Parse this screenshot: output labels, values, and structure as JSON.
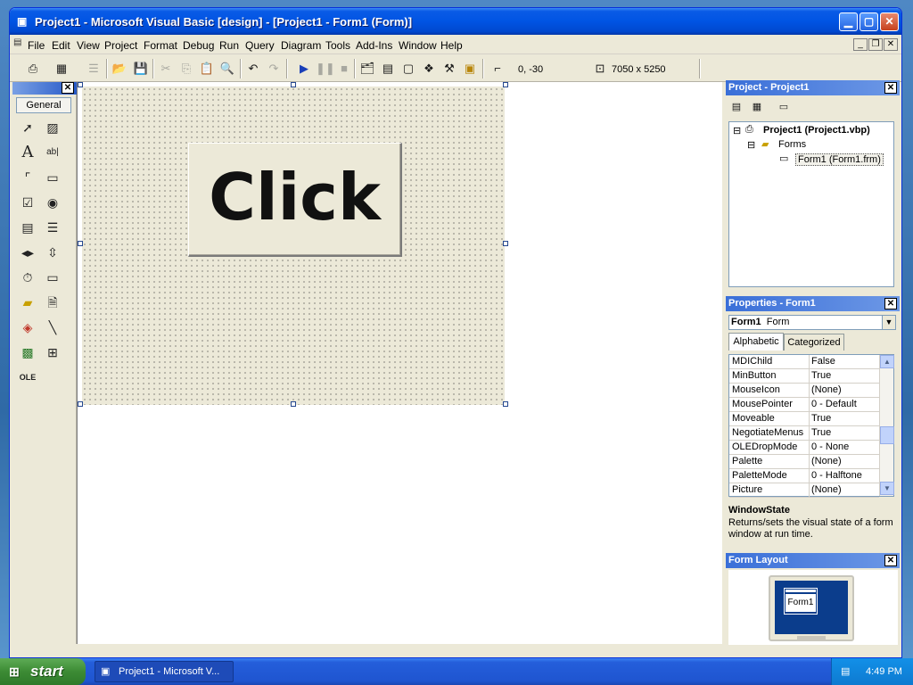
{
  "window": {
    "title": "Project1 - Microsoft Visual Basic [design] - [Project1 - Form1 (Form)]",
    "min_glyph": "▁",
    "max_glyph": "▢",
    "close_glyph": "✕"
  },
  "menu": [
    "File",
    "Edit",
    "View",
    "Project",
    "Format",
    "Debug",
    "Run",
    "Query",
    "Diagram",
    "Tools",
    "Add-Ins",
    "Window",
    "Help"
  ],
  "mdi_buttons": [
    "_",
    "❐",
    "✕"
  ],
  "toolbar": {
    "position": "0, -30",
    "size": "7050 x 5250"
  },
  "toolbox": {
    "tab_label": "General",
    "close_glyph": "✕"
  },
  "form": {
    "button_caption": "Click"
  },
  "project_panel": {
    "title": "Project - Project1",
    "close_glyph": "✕",
    "tree": {
      "project": "Project1 (Project1.vbp)",
      "folder": "Forms",
      "form": "Form1 (Form1.frm)"
    }
  },
  "properties_panel": {
    "title": "Properties - Form1",
    "close_glyph": "✕",
    "object_name": "Form1",
    "object_type": "Form",
    "tabs": [
      "Alphabetic",
      "Categorized"
    ],
    "rows": [
      {
        "name": "MDIChild",
        "value": "False"
      },
      {
        "name": "MinButton",
        "value": "True"
      },
      {
        "name": "MouseIcon",
        "value": "(None)"
      },
      {
        "name": "MousePointer",
        "value": "0 - Default"
      },
      {
        "name": "Moveable",
        "value": "True"
      },
      {
        "name": "NegotiateMenus",
        "value": "True"
      },
      {
        "name": "OLEDropMode",
        "value": "0 - None"
      },
      {
        "name": "Palette",
        "value": "(None)"
      },
      {
        "name": "PaletteMode",
        "value": "0 - Halftone"
      },
      {
        "name": "Picture",
        "value": "(None)"
      }
    ],
    "description_title": "WindowState",
    "description_text": "Returns/sets the visual state of a form window at run time."
  },
  "layout_panel": {
    "title": "Form Layout",
    "close_glyph": "✕",
    "form_label": "Form1"
  },
  "taskbar": {
    "start_label": "start",
    "task_label": "Project1 - Microsoft V...",
    "clock": "4:49 PM"
  }
}
